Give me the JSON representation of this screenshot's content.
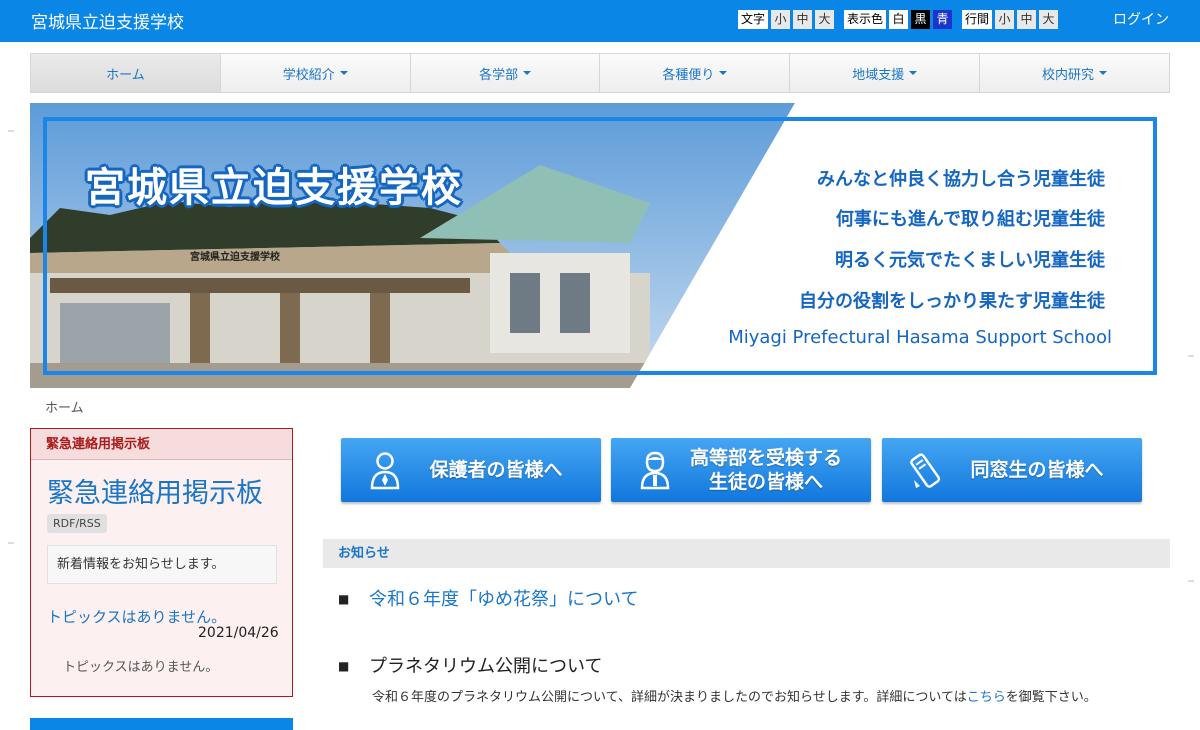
{
  "header": {
    "site_title": "宮城県立迫支援学校",
    "font_size_label": "文字",
    "font_sizes": [
      "小",
      "中",
      "大"
    ],
    "color_label": "表示色",
    "colors": [
      "白",
      "黒",
      "青"
    ],
    "line_spacing_label": "行間",
    "line_spacings": [
      "小",
      "中",
      "大"
    ],
    "login": "ログイン"
  },
  "nav": {
    "items": [
      {
        "label": "ホーム",
        "dropdown": false
      },
      {
        "label": "学校紹介",
        "dropdown": true
      },
      {
        "label": "各学部",
        "dropdown": true
      },
      {
        "label": "各種便り",
        "dropdown": true
      },
      {
        "label": "地域支援",
        "dropdown": true
      },
      {
        "label": "校内研究",
        "dropdown": true
      }
    ]
  },
  "banner": {
    "title": "宮城県立迫支援学校",
    "mottos": [
      "みんなと仲良く協力し合う児童生徒",
      "何事にも進んで取り組む児童生徒",
      "明るく元気でたくましい児童生徒",
      "自分の役割をしっかり果たす児童生徒"
    ],
    "english_name": "Miyagi Prefectural Hasama Support School",
    "building_sign": "宮城県立迫支援学校"
  },
  "breadcrumb": "ホーム",
  "emergency_board": {
    "header": "緊急連絡用掲示板",
    "title": "緊急連絡用掲示板",
    "rss_label": "RDF/RSS",
    "notice": "新着情報をお知らせします。",
    "topics_link": "トピックスはありません。",
    "date": "2021/04/26",
    "topics_none": "トピックスはありません。"
  },
  "buttons": [
    {
      "label": "保護者の皆様へ",
      "icon": "person-icon"
    },
    {
      "label_line1": "高等部を受検する",
      "label_line2": "生徒の皆様へ",
      "icon": "student-icon"
    },
    {
      "label": "同窓生の皆様へ",
      "icon": "diploma-icon"
    }
  ],
  "news": {
    "header": "お知らせ",
    "bullet": "■",
    "item1": "令和６年度「ゆめ花祭」について",
    "item2_title": "プラネタリウム公開について",
    "item2_body_pre": "令和６年度のプラネタリウム公開について、詳細が決まりましたのでお知らせします。詳細については",
    "item2_body_link": "こちら",
    "item2_body_post": "を御覧下さい。"
  },
  "colors": {
    "brand_blue": "#0a86e6",
    "link_blue": "#1a76c9",
    "emergency_red": "#a81c1c"
  }
}
